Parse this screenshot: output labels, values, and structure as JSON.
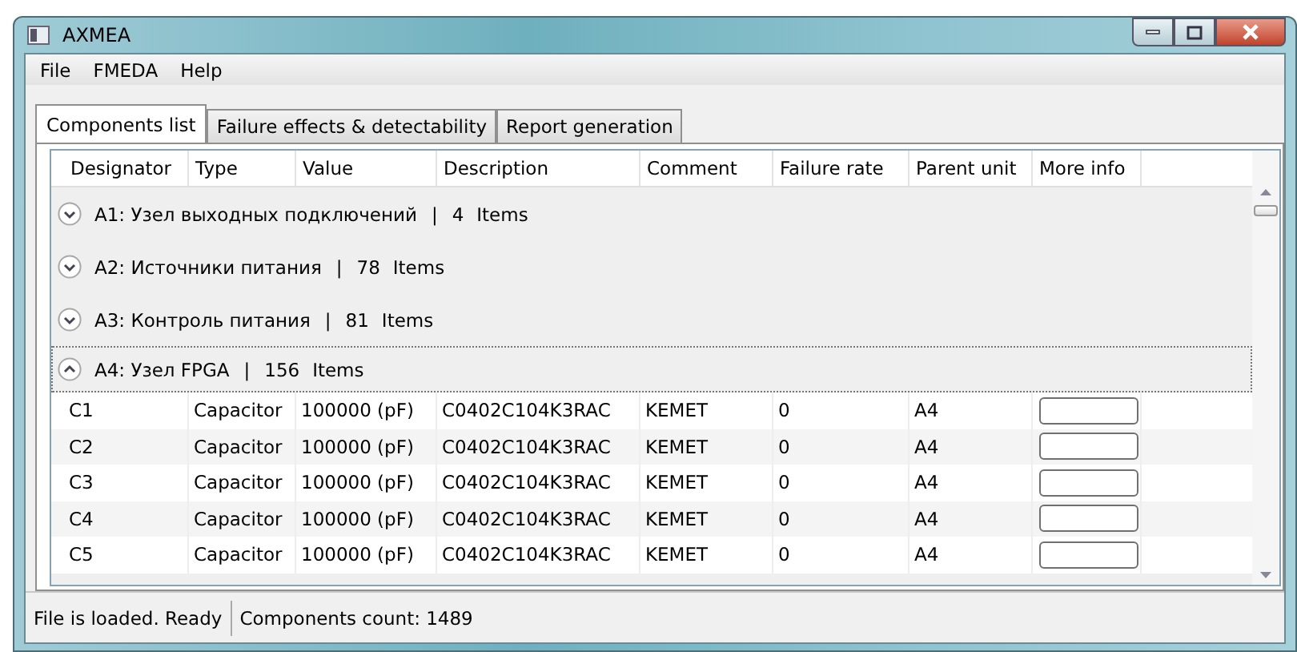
{
  "window": {
    "title": "AXMEA"
  },
  "menu": [
    "File",
    "FMEDA",
    "Help"
  ],
  "tabs": [
    {
      "label": "Components list",
      "selected": true
    },
    {
      "label": "Failure effects & detectability",
      "selected": false
    },
    {
      "label": "Report generation",
      "selected": false
    }
  ],
  "table": {
    "columns": [
      "Designator",
      "Type",
      "Value",
      "Description",
      "Comment",
      "Failure rate",
      "Parent unit",
      "More info"
    ],
    "groups": [
      {
        "name": "A1: Узел выходных подключений",
        "separator": "|",
        "count": "4",
        "items_label": "Items",
        "expanded": false,
        "selected": false
      },
      {
        "name": "A2: Источники питания",
        "separator": "|",
        "count": "78",
        "items_label": "Items",
        "expanded": false,
        "selected": false
      },
      {
        "name": "A3: Контроль питания",
        "separator": "|",
        "count": "81",
        "items_label": "Items",
        "expanded": false,
        "selected": false
      },
      {
        "name": "A4: Узел FPGA",
        "separator": "|",
        "count": "156",
        "items_label": "Items",
        "expanded": true,
        "selected": true,
        "rows": [
          [
            "C1",
            "Capacitor",
            "100000 (pF)",
            "C0402C104K3RAC",
            "KEMET",
            "0",
            "A4"
          ],
          [
            "C2",
            "Capacitor",
            "100000 (pF)",
            "C0402C104K3RAC",
            "KEMET",
            "0",
            "A4"
          ],
          [
            "C3",
            "Capacitor",
            "100000 (pF)",
            "C0402C104K3RAC",
            "KEMET",
            "0",
            "A4"
          ],
          [
            "C4",
            "Capacitor",
            "100000 (pF)",
            "C0402C104K3RAC",
            "KEMET",
            "0",
            "A4"
          ],
          [
            "C5",
            "Capacitor",
            "100000 (pF)",
            "C0402C104K3RAC",
            "KEMET",
            "0",
            "A4"
          ]
        ]
      }
    ]
  },
  "status_bar": [
    "File is loaded. Ready",
    "Components count: 1489"
  ]
}
